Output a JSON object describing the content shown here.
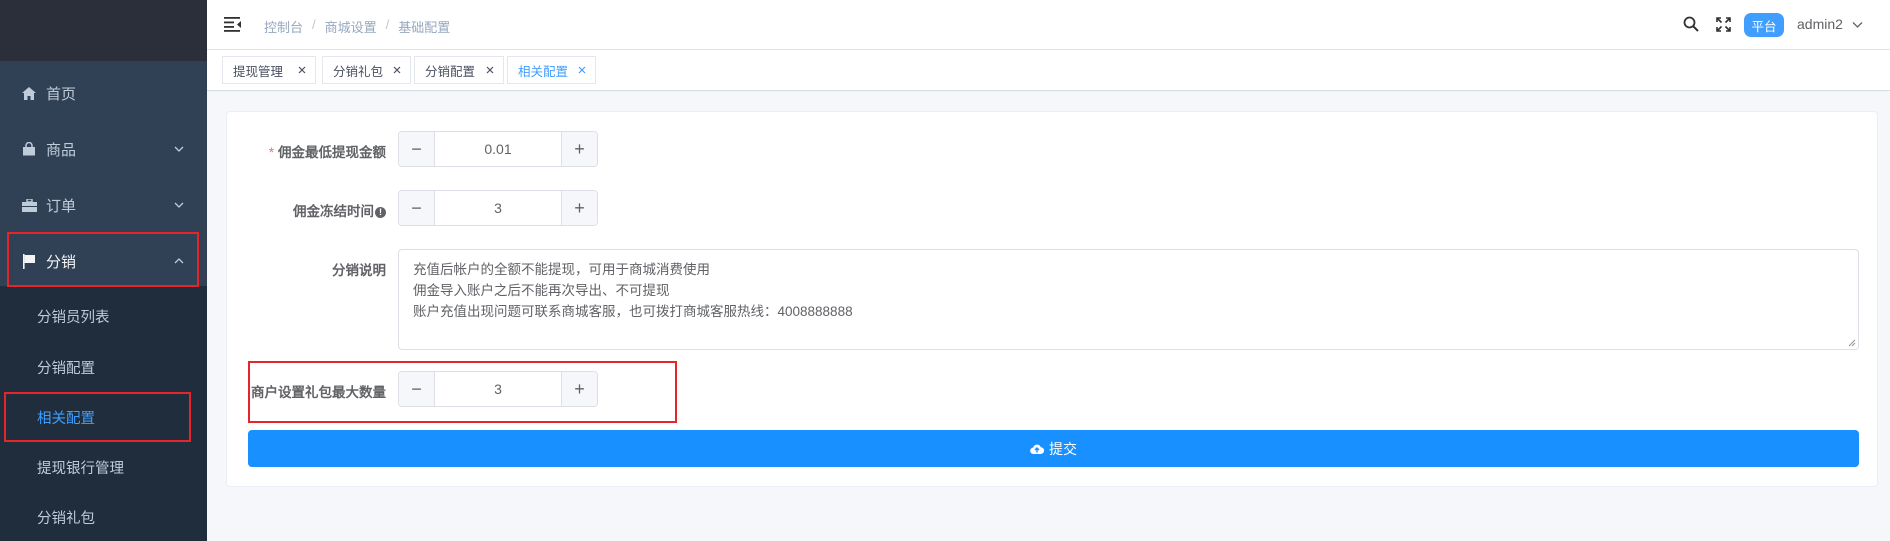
{
  "sidebar": {
    "menu": [
      {
        "label": "首页",
        "icon": "home-icon"
      },
      {
        "label": "商品",
        "icon": "bag-icon"
      },
      {
        "label": "订单",
        "icon": "briefcase-icon"
      },
      {
        "label": "分销",
        "icon": "flag-icon"
      }
    ],
    "submenu": [
      {
        "label": "分销员列表"
      },
      {
        "label": "分销配置"
      },
      {
        "label": "相关配置",
        "active": true
      },
      {
        "label": "提现银行管理"
      },
      {
        "label": "分销礼包"
      }
    ]
  },
  "header": {
    "breadcrumb": [
      "控制台",
      "商城设置",
      "基础配置"
    ],
    "breadcrumb_sep": "/",
    "platform_badge": "平台",
    "username": "admin2"
  },
  "tags": [
    {
      "label": "提现管理"
    },
    {
      "label": "分销礼包"
    },
    {
      "label": "分销配置"
    },
    {
      "label": "相关配置",
      "active": true
    }
  ],
  "form": {
    "min_withdraw": {
      "required_mark": "*",
      "label": "佣金最低提现金额",
      "value": "0.01"
    },
    "freeze_time": {
      "label": "佣金冻结时间",
      "info": "!",
      "value": "3"
    },
    "description": {
      "label": "分销说明",
      "lines": [
        "充值后帐户的全额不能提现，可用于商城消费使用",
        "佣金导入账户之后不能再次导出、不可提现",
        "账户充值出现问题可联系商城客服，也可拨打商城客服热线：4008888888"
      ]
    },
    "gift_max": {
      "label": "商户设置礼包最大数量",
      "value": "3"
    },
    "stepper_minus": "−",
    "stepper_plus": "+",
    "submit_label": "提交"
  },
  "colors": {
    "sidebar_bg": "#304156",
    "submenu_bg": "#1f2d3d",
    "accent": "#409eff",
    "submit": "#1890ff",
    "highlight_box": "#e5252a"
  }
}
